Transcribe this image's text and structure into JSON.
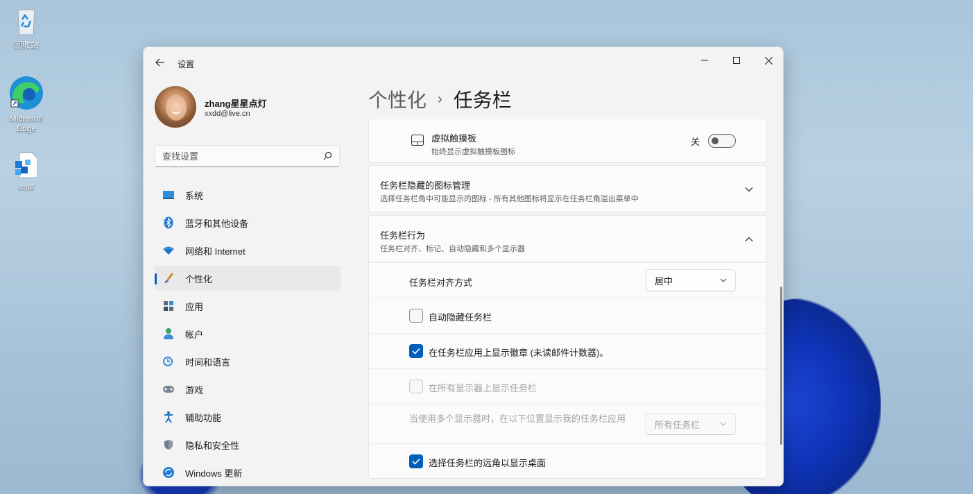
{
  "desktop": {
    "icons": [
      {
        "label": "回收站",
        "icon": "recycle-bin-icon"
      },
      {
        "label": "Microsoft Edge",
        "icon": "edge-icon"
      },
      {
        "label": "asdf",
        "icon": "archive-icon"
      }
    ]
  },
  "window": {
    "title": "设置",
    "controls": {
      "minimize": "minimize-icon",
      "maximize": "maximize-icon",
      "close": "close-icon"
    }
  },
  "profile": {
    "name": "zhang星星点灯",
    "email": "xxdd@live.cn"
  },
  "search": {
    "placeholder": "查找设置"
  },
  "nav": {
    "items": [
      {
        "label": "系统",
        "icon": "system-icon"
      },
      {
        "label": "蓝牙和其他设备",
        "icon": "bluetooth-icon"
      },
      {
        "label": "网络和 Internet",
        "icon": "wifi-icon"
      },
      {
        "label": "个性化",
        "icon": "brush-icon",
        "active": true
      },
      {
        "label": "应用",
        "icon": "apps-icon"
      },
      {
        "label": "帐户",
        "icon": "account-icon"
      },
      {
        "label": "时间和语言",
        "icon": "clock-globe-icon"
      },
      {
        "label": "游戏",
        "icon": "gamepad-icon"
      },
      {
        "label": "辅助功能",
        "icon": "accessibility-icon"
      },
      {
        "label": "隐私和安全性",
        "icon": "shield-icon"
      },
      {
        "label": "Windows 更新",
        "icon": "update-icon"
      }
    ]
  },
  "breadcrumb": {
    "parent": "个性化",
    "separator": "›",
    "current": "任务栏"
  },
  "touchpad": {
    "title": "虚拟触摸板",
    "subtitle": "始终显示虚拟触摸板图标",
    "toggle_label": "关",
    "toggle_on": false
  },
  "hidden_icons": {
    "title": "任务栏隐藏的图标管理",
    "subtitle": "选择任务栏角中可能显示的图标 - 所有其他图标将显示在任务栏角溢出菜单中"
  },
  "behaviors": {
    "title": "任务栏行为",
    "subtitle": "任务栏对齐、标记、自动隐藏和多个显示器",
    "alignment_label": "任务栏对齐方式",
    "alignment_value": "居中",
    "autohide_label": "自动隐藏任务栏",
    "autohide_checked": false,
    "badges_label": "在任务栏应用上显示徽章 (未读邮件计数器)。",
    "badges_checked": true,
    "all_displays_label": "在所有显示器上显示任务栏",
    "all_displays_checked": false,
    "multi_display_label": "当使用多个显示器时，在以下位置显示我的任务栏应用",
    "multi_display_value": "所有任务栏",
    "far_corner_label": "选择任务栏的远角以显示桌面",
    "far_corner_checked": true
  },
  "colors": {
    "accent": "#005fb8",
    "bg": "#f3f3f3",
    "card": "#fbfbfb"
  }
}
